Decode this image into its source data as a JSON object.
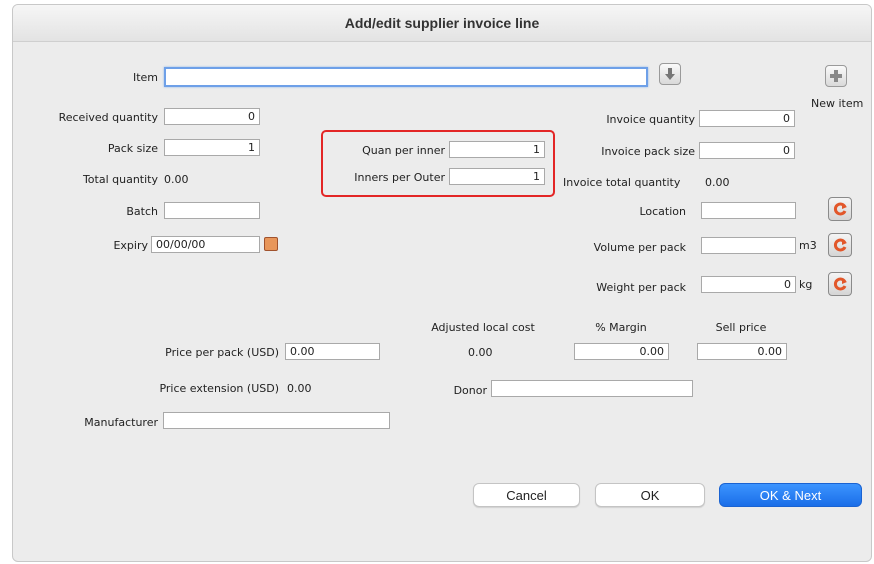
{
  "window": {
    "title": "Add/edit supplier invoice line"
  },
  "item": {
    "label": "Item",
    "value": "",
    "new_item_label": "New item"
  },
  "left": {
    "received_quantity": {
      "label": "Received quantity",
      "value": "0"
    },
    "pack_size": {
      "label": "Pack size",
      "value": "1"
    },
    "total_quantity": {
      "label": "Total quantity",
      "value": "0.00"
    },
    "batch": {
      "label": "Batch",
      "value": ""
    },
    "expiry": {
      "label": "Expiry",
      "value": "00/00/00"
    }
  },
  "middle": {
    "quan_per_inner": {
      "label": "Quan per inner",
      "value": "1"
    },
    "inners_per_outer": {
      "label": "Inners per Outer",
      "value": "1"
    }
  },
  "right": {
    "invoice_quantity": {
      "label": "Invoice quantity",
      "value": "0"
    },
    "invoice_pack_size": {
      "label": "Invoice pack size",
      "value": "0"
    },
    "invoice_total_quantity": {
      "label": "Invoice total quantity",
      "value": "0.00"
    },
    "location": {
      "label": "Location",
      "value": ""
    },
    "volume_per_pack": {
      "label": "Volume per pack",
      "value": "",
      "unit": "m3"
    },
    "weight_per_pack": {
      "label": "Weight per pack",
      "value": "0",
      "unit": "kg"
    }
  },
  "pricing": {
    "price_per_pack": {
      "label": "Price per pack (USD)",
      "value": "0.00"
    },
    "adjusted_local_cost": {
      "label": "Adjusted local cost",
      "value": "0.00"
    },
    "margin": {
      "label": "% Margin",
      "value": "0.00"
    },
    "sell_price": {
      "label": "Sell price",
      "value": "0.00"
    },
    "price_extension": {
      "label": "Price extension (USD)",
      "value": "0.00"
    },
    "donor": {
      "label": "Donor",
      "value": ""
    },
    "manufacturer": {
      "label": "Manufacturer",
      "value": ""
    }
  },
  "buttons": {
    "cancel": "Cancel",
    "ok": "OK",
    "ok_next": "OK & Next"
  },
  "icons": {
    "item_lookup": "download-arrow-icon",
    "new_item": "plus-icon",
    "refresh": "refresh-icon",
    "calendar": "calendar-icon"
  },
  "colors": {
    "highlight": "#e32626",
    "primary_button": "#1a6ee8",
    "refresh_icon": "#e2572a"
  }
}
